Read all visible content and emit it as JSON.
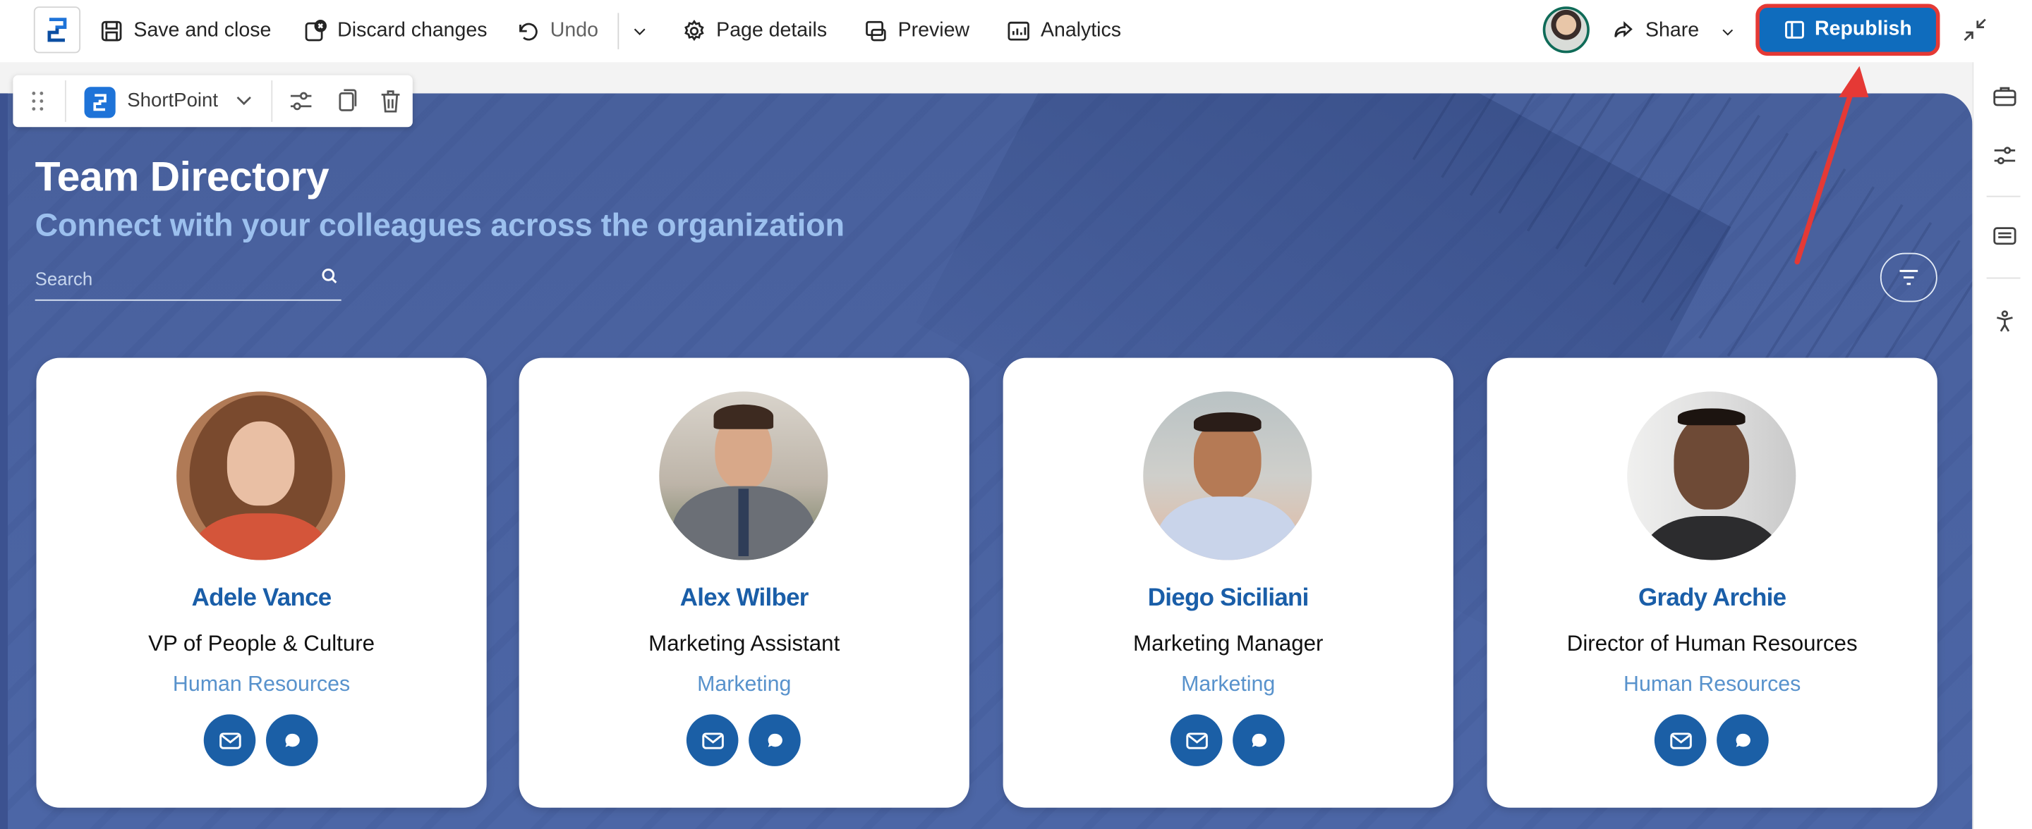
{
  "toolbar": {
    "save_close": "Save and close",
    "discard": "Discard changes",
    "undo": "Undo",
    "page_details": "Page details",
    "preview": "Preview",
    "analytics": "Analytics",
    "share": "Share",
    "republish": "Republish"
  },
  "webpart_toolbar": {
    "name": "ShortPoint"
  },
  "hero": {
    "title": "Team Directory",
    "subtitle": "Connect with your colleagues across the organization",
    "search_placeholder": "Search"
  },
  "people": [
    {
      "name": "Adele Vance",
      "title": "VP of People & Culture",
      "department": "Human Resources"
    },
    {
      "name": "Alex Wilber",
      "title": "Marketing Assistant",
      "department": "Marketing"
    },
    {
      "name": "Diego Siciliani",
      "title": "Marketing Manager",
      "department": "Marketing"
    },
    {
      "name": "Grady Archie",
      "title": "Director of Human Resources",
      "department": "Human Resources"
    }
  ],
  "colors": {
    "accent": "#0f6cbd",
    "highlight_border": "#e53935",
    "name_blue": "#1a5ea8",
    "department_blue": "#5892cc",
    "hero_bg": "#4a62a0"
  },
  "icons": {
    "app": "sharepoint-logo-icon",
    "save": "save-icon",
    "discard": "discard-icon",
    "undo": "undo-icon",
    "page_details": "gear-icon",
    "preview": "preview-icon",
    "analytics": "analytics-icon",
    "share": "share-icon",
    "republish": "book-icon",
    "collapse": "collapse-icon",
    "email": "mail-icon",
    "chat": "chat-icon",
    "filter": "filter-icon"
  }
}
